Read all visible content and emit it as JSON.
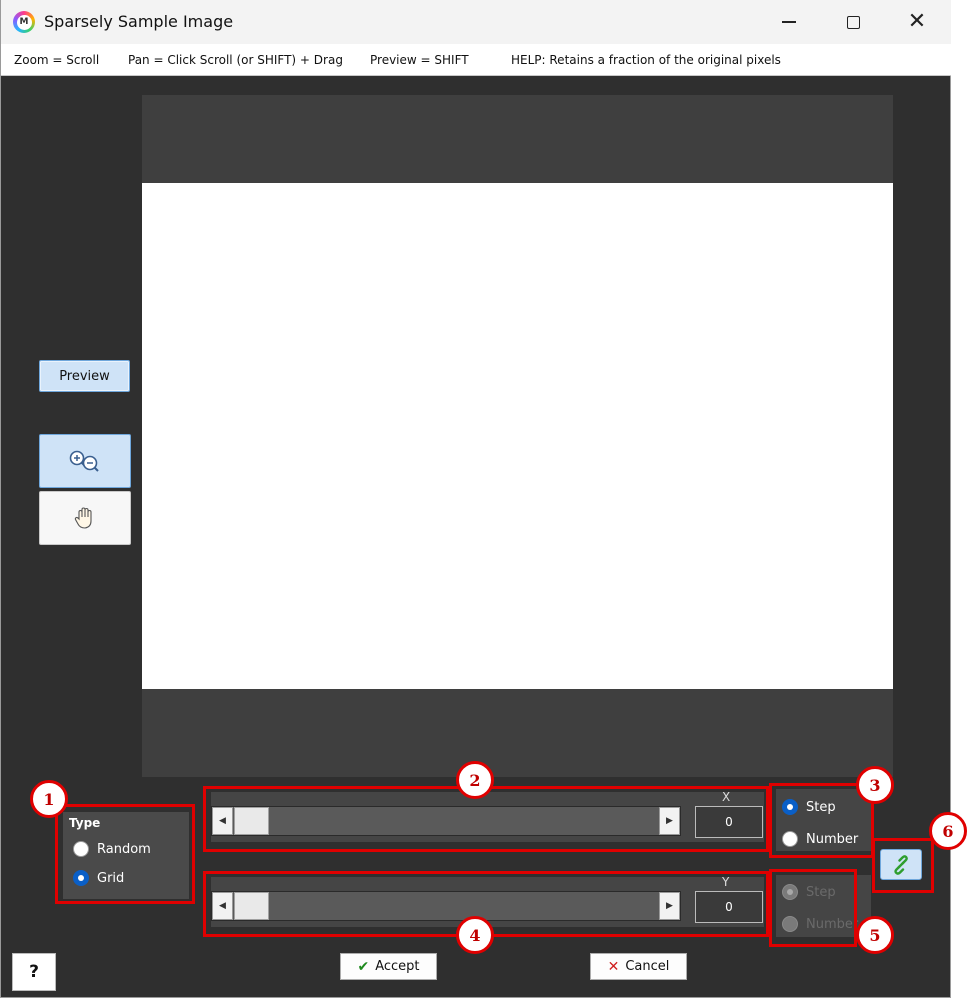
{
  "window": {
    "title": "Sparsely Sample Image",
    "app_icon_letter": "M"
  },
  "helpbar": {
    "zoom": "Zoom = Scroll",
    "pan": "Pan = Click Scroll (or SHIFT) + Drag",
    "preview": "Preview = SHIFT",
    "help": "HELP:  Retains a fraction of the original pixels"
  },
  "tools": {
    "preview_label": "Preview",
    "zoom_icon": "zoom-in-out-icon",
    "pan_icon": "hand-pan-icon"
  },
  "type_group": {
    "title": "Type",
    "options": [
      {
        "label": "Random",
        "checked": false
      },
      {
        "label": "Grid",
        "checked": true
      }
    ]
  },
  "x_slider": {
    "axis_label": "X",
    "value": "0",
    "position": 0
  },
  "y_slider": {
    "axis_label": "Y",
    "value": "0",
    "position": 0
  },
  "x_mode": {
    "options": [
      {
        "label": "Step",
        "checked": true
      },
      {
        "label": "Number",
        "checked": false
      }
    ]
  },
  "y_mode": {
    "enabled": false,
    "options": [
      {
        "label": "Step",
        "checked": true
      },
      {
        "label": "Number",
        "checked": false
      }
    ]
  },
  "link": {
    "icon": "link-chain-icon",
    "color": "#2f9e2f"
  },
  "actions": {
    "accept_label": "Accept",
    "cancel_label": "Cancel",
    "help_label": "?"
  },
  "callouts": [
    "1",
    "2",
    "3",
    "4",
    "5",
    "6"
  ],
  "colors": {
    "annotation_red": "#e00000",
    "accent_blue": "#0a5fc7",
    "canvas_bg": "#3f3f3f"
  }
}
